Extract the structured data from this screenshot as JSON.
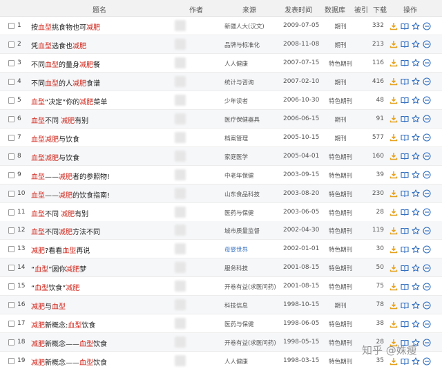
{
  "header": {
    "title": "题名",
    "author": "作者",
    "source": "来源",
    "date": "发表时间",
    "db": "数据库",
    "cited": "被引",
    "downloads": "下载",
    "ops": "操作"
  },
  "colors": {
    "keyword": "#d0261b",
    "link": "#3a74c2",
    "icon": "#2f6dbf",
    "download": "#e6a11c"
  },
  "icon_names": [
    "download-icon",
    "read-icon",
    "favorite-icon",
    "share-icon"
  ],
  "rows": [
    {
      "num": "1",
      "title": [
        [
          "按",
          0
        ],
        [
          "血型",
          1
        ],
        [
          "挑食物也可",
          0
        ],
        [
          "减肥",
          1
        ]
      ],
      "source": "新疆人大(汉文)",
      "date": "2009-07-05",
      "db": "期刊",
      "downloads": "332"
    },
    {
      "num": "2",
      "title": [
        [
          "凭",
          0
        ],
        [
          "血型",
          1
        ],
        [
          "选食也",
          0
        ],
        [
          "减肥",
          1
        ]
      ],
      "source": "品牌与标准化",
      "date": "2008-11-08",
      "db": "期刊",
      "downloads": "213"
    },
    {
      "num": "3",
      "title": [
        [
          "不同",
          0
        ],
        [
          "血型",
          1
        ],
        [
          "的量身",
          0
        ],
        [
          "减肥",
          1
        ],
        [
          "餐",
          0
        ]
      ],
      "source": "人人健康",
      "date": "2007-07-15",
      "db": "特色期刊",
      "downloads": "116"
    },
    {
      "num": "4",
      "title": [
        [
          "不同",
          0
        ],
        [
          "血型",
          1
        ],
        [
          "的人",
          0
        ],
        [
          "减肥",
          1
        ],
        [
          "食谱",
          0
        ]
      ],
      "source": "统计与咨询",
      "date": "2007-02-10",
      "db": "期刊",
      "downloads": "416"
    },
    {
      "num": "5",
      "title": [
        [
          "血型",
          1
        ],
        [
          "“决定”你的",
          0
        ],
        [
          "减肥",
          1
        ],
        [
          "菜单",
          0
        ]
      ],
      "source": "少年读者",
      "date": "2006-10-30",
      "db": "特色期刊",
      "downloads": "48"
    },
    {
      "num": "6",
      "title": [
        [
          "血型",
          1
        ],
        [
          "不同 ",
          0
        ],
        [
          "减肥",
          1
        ],
        [
          "有别",
          0
        ]
      ],
      "source": "医疗保健器具",
      "date": "2006-06-15",
      "db": "期刊",
      "downloads": "91"
    },
    {
      "num": "7",
      "title": [
        [
          "血型",
          1
        ],
        [
          "减肥",
          1
        ],
        [
          "与饮食",
          0
        ]
      ],
      "source": "档案管理",
      "date": "2005-10-15",
      "db": "期刊",
      "downloads": "577"
    },
    {
      "num": "8",
      "title": [
        [
          "血型",
          1
        ],
        [
          "减肥",
          1
        ],
        [
          "与饮食",
          0
        ]
      ],
      "source": "家庭医学",
      "date": "2005-04-01",
      "db": "特色期刊",
      "downloads": "160"
    },
    {
      "num": "9",
      "title": [
        [
          "血型",
          1
        ],
        [
          "——",
          0
        ],
        [
          "减肥",
          1
        ],
        [
          "者的参照物!",
          0
        ]
      ],
      "source": "中老年保健",
      "date": "2003-09-15",
      "db": "特色期刊",
      "downloads": "39"
    },
    {
      "num": "10",
      "title": [
        [
          "血型",
          1
        ],
        [
          "——",
          0
        ],
        [
          "减肥",
          1
        ],
        [
          "的饮食指南!",
          0
        ]
      ],
      "source": "山东食品科技",
      "date": "2003-08-20",
      "db": "特色期刊",
      "downloads": "230"
    },
    {
      "num": "11",
      "title": [
        [
          "血型",
          1
        ],
        [
          "不同 ",
          0
        ],
        [
          "减肥",
          1
        ],
        [
          "有别",
          0
        ]
      ],
      "source": "医药与保健",
      "date": "2003-06-05",
      "db": "特色期刊",
      "downloads": "28"
    },
    {
      "num": "12",
      "title": [
        [
          "血型",
          1
        ],
        [
          "不同",
          0
        ],
        [
          "减肥",
          1
        ],
        [
          "方法不同",
          0
        ]
      ],
      "source": "城市质量监督",
      "date": "2002-04-30",
      "db": "特色期刊",
      "downloads": "119"
    },
    {
      "num": "13",
      "title": [
        [
          "减肥",
          1
        ],
        [
          "?看看",
          0
        ],
        [
          "血型",
          1
        ],
        [
          "再说",
          0
        ]
      ],
      "source": "母婴世界",
      "source_link": true,
      "date": "2002-01-01",
      "db": "特色期刊",
      "downloads": "30"
    },
    {
      "num": "14",
      "title": [
        [
          "“",
          0
        ],
        [
          "血型",
          1
        ],
        [
          "”圆你",
          0
        ],
        [
          "减肥",
          1
        ],
        [
          "梦",
          0
        ]
      ],
      "source": "服务科技",
      "date": "2001-08-15",
      "db": "特色期刊",
      "downloads": "50"
    },
    {
      "num": "15",
      "title": [
        [
          "“",
          0
        ],
        [
          "血型",
          1
        ],
        [
          "饮食”",
          0
        ],
        [
          "减肥",
          1
        ]
      ],
      "source": "开卷有益(求医问药)",
      "date": "2001-08-15",
      "db": "特色期刊",
      "downloads": "75"
    },
    {
      "num": "16",
      "title": [
        [
          "减肥",
          1
        ],
        [
          "与",
          0
        ],
        [
          "血型",
          1
        ]
      ],
      "source": "科技信息",
      "date": "1998-10-15",
      "db": "期刊",
      "downloads": "78"
    },
    {
      "num": "17",
      "title": [
        [
          "减肥",
          1
        ],
        [
          "新概念:",
          0
        ],
        [
          "血型",
          1
        ],
        [
          "饮食",
          0
        ]
      ],
      "source": "医药与保健",
      "date": "1998-06-05",
      "db": "特色期刊",
      "downloads": "38"
    },
    {
      "num": "18",
      "title": [
        [
          "减肥",
          1
        ],
        [
          "新概念——",
          0
        ],
        [
          "血型",
          1
        ],
        [
          "饮食",
          0
        ]
      ],
      "source": "开卷有益(求医问药)",
      "date": "1998-05-15",
      "db": "特色期刊",
      "downloads": "28"
    },
    {
      "num": "19",
      "title": [
        [
          "减肥",
          1
        ],
        [
          "新概念——",
          0
        ],
        [
          "血型",
          1
        ],
        [
          "饮食",
          0
        ]
      ],
      "source": "人人健康",
      "date": "1998-03-15",
      "db": "特色期刊",
      "downloads": "35"
    }
  ],
  "watermark": "知乎 @姝瘦"
}
